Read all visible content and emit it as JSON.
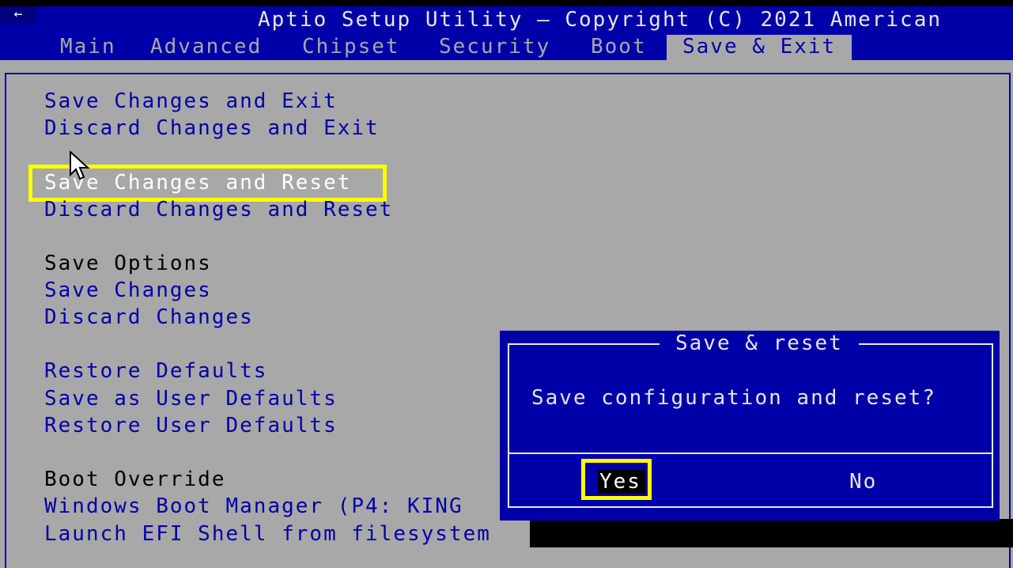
{
  "header": {
    "back_glyph": "←",
    "title": "Aptio Setup Utility – Copyright (C) 2021 American"
  },
  "tabs": [
    {
      "label": "Main"
    },
    {
      "label": "Advanced"
    },
    {
      "label": "Chipset"
    },
    {
      "label": "Security"
    },
    {
      "label": "Boot"
    },
    {
      "label": "Save & Exit",
      "active": true
    }
  ],
  "menu": {
    "save_changes_and_exit": "Save Changes and Exit",
    "discard_changes_and_exit": "Discard Changes and Exit",
    "save_changes_and_reset": "Save Changes and Reset",
    "discard_changes_and_reset": "Discard Changes and Reset",
    "save_options_label": "Save Options",
    "save_changes": "Save Changes",
    "discard_changes": "Discard Changes",
    "restore_defaults": "Restore Defaults",
    "save_as_user_defaults": "Save as User Defaults",
    "restore_user_defaults": "Restore User Defaults",
    "boot_override_label": "Boot Override",
    "windows_boot_manager": "Windows Boot Manager (P4: KING",
    "launch_efi_shell": "Launch EFI Shell from filesystem"
  },
  "dialog": {
    "title": "Save & reset",
    "message": "Save configuration and reset?",
    "yes": "Yes",
    "no": "No"
  },
  "colors": {
    "bios_blue": "#0000a8",
    "bios_gray": "#a8a8a8",
    "highlight_yellow": "#ffff00"
  }
}
